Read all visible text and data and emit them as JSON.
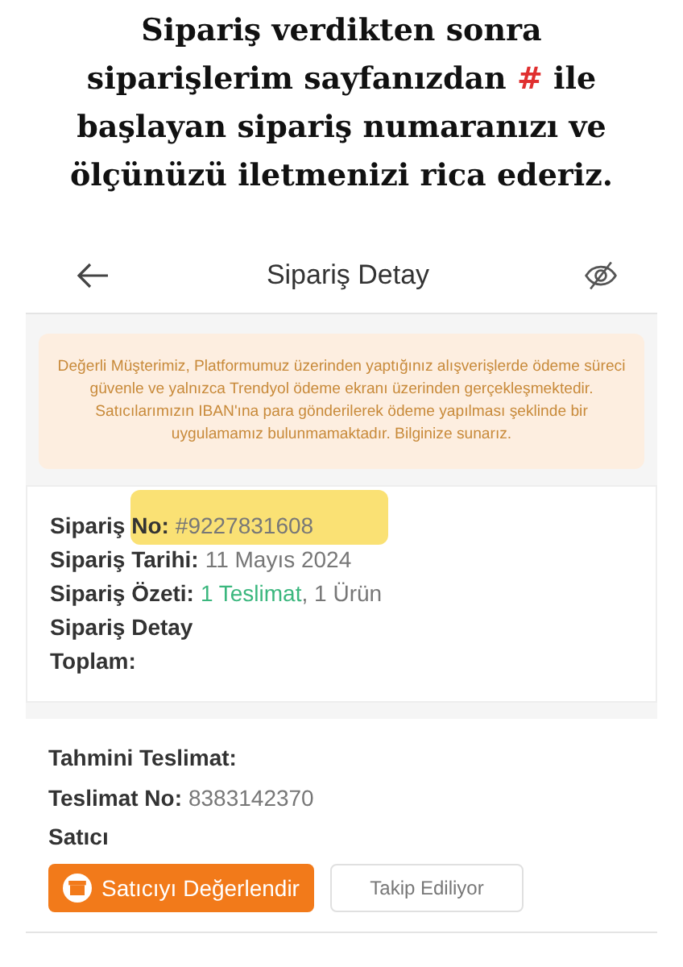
{
  "caption": {
    "before": "Sipariş verdikten sonra siparişlerim sayfanızdan ",
    "mark": "#",
    "after": " ile başlayan sipariş numaranızı ve ölçünüzü iletmenizi rica ederiz."
  },
  "header": {
    "title": "Sipariş Detay"
  },
  "notice": "Değerli Müşterimiz, Platformumuz üzerinden yaptığınız alışverişlerde ödeme süreci güvenle ve yalnızca Trendyol ödeme ekranı üzerinden gerçekleşmektedir. Satıcılarımızın IBAN'ına para gönderilerek ödeme yapılması şeklinde bir uygulamamız bulunmamaktadır. Bilginize sunarız.",
  "order": [
    {
      "label": "Sipariş No:",
      "highlighted": true,
      "parts": [
        {
          "kind": "plain",
          "text": "#9227831608"
        }
      ]
    },
    {
      "label": "Sipariş Tarihi:",
      "highlighted": false,
      "parts": [
        {
          "kind": "plain",
          "text": "11 Mayıs 2024"
        }
      ]
    },
    {
      "label": "Sipariş Özeti:",
      "highlighted": false,
      "parts": [
        {
          "kind": "link",
          "text": "1 Teslimat"
        },
        {
          "kind": "plain",
          "text": ", 1 Ürün"
        }
      ]
    },
    {
      "label": "Sipariş Detay",
      "highlighted": false
    },
    {
      "label": "Toplam:",
      "highlighted": false
    }
  ],
  "delivery": [
    {
      "label": "Tahmini Teslimat:"
    },
    {
      "label": "Teslimat No:",
      "value": "8383142370"
    },
    {
      "label": "Satıcı"
    }
  ],
  "buttons": [
    {
      "kind": "primary",
      "label": "Satıcıyı Değerlendir"
    },
    {
      "kind": "secondary",
      "label": "Takip Ediliyor"
    }
  ]
}
